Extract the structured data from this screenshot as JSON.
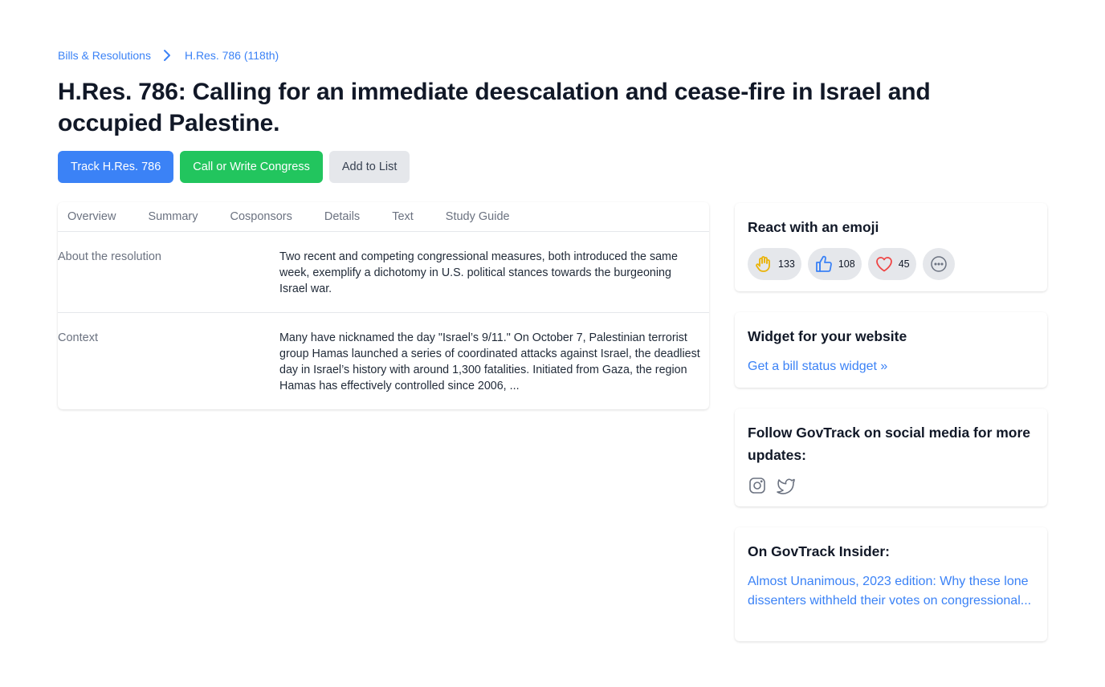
{
  "breadcrumb": {
    "parent": "Bills & Resolutions",
    "current": "H.Res. 786 (118th)"
  },
  "page_title": "H.Res. 786: Calling for an immediate deescalation and cease-fire in Israel and occupied Palestine.",
  "actions": {
    "track": "Track H.Res. 786",
    "call": "Call or Write Congress",
    "add_list": "Add to List"
  },
  "tabs": [
    "Overview",
    "Summary",
    "Cosponsors",
    "Details",
    "Text",
    "Study Guide"
  ],
  "overview": {
    "rows": [
      {
        "label": "About the resolution",
        "text": "Two recent and competing congressional measures, both introduced the same week, exemplify a dichotomy in U.S. political stances towards the burgeoning Israel war."
      },
      {
        "label": "Context",
        "text": "Many have nicknamed the day \"Israel’s 9/11.\" On October 7, Palestinian terrorist group Hamas launched a series of coordinated attacks against Israel, the deadliest day in Israel’s history with around 1,300 fatalities. Initiated from Gaza, the region Hamas has effectively controlled since 2006, ..."
      }
    ]
  },
  "react": {
    "heading": "React with an emoji",
    "items": [
      {
        "icon": "raised-hand-icon",
        "count": "133"
      },
      {
        "icon": "thumbs-up-icon",
        "count": "108"
      },
      {
        "icon": "heart-icon",
        "count": "45"
      },
      {
        "icon": "more-icon"
      }
    ]
  },
  "widget": {
    "heading": "Widget for your website",
    "link": "Get a bill status widget »"
  },
  "follow": {
    "heading": "Follow GovTrack on social media for more updates:",
    "icons": [
      "instagram-icon",
      "twitter-icon"
    ]
  },
  "insider": {
    "heading": "On GovTrack Insider:",
    "link": "Almost Unanimous, 2023 edition: Why these lone dissenters withheld their votes on congressional..."
  },
  "colors": {
    "primary": "#3b82f6",
    "success": "#22c55e",
    "muted": "#e5e7eb",
    "hand": "#eab308",
    "heart": "#ef4444"
  }
}
